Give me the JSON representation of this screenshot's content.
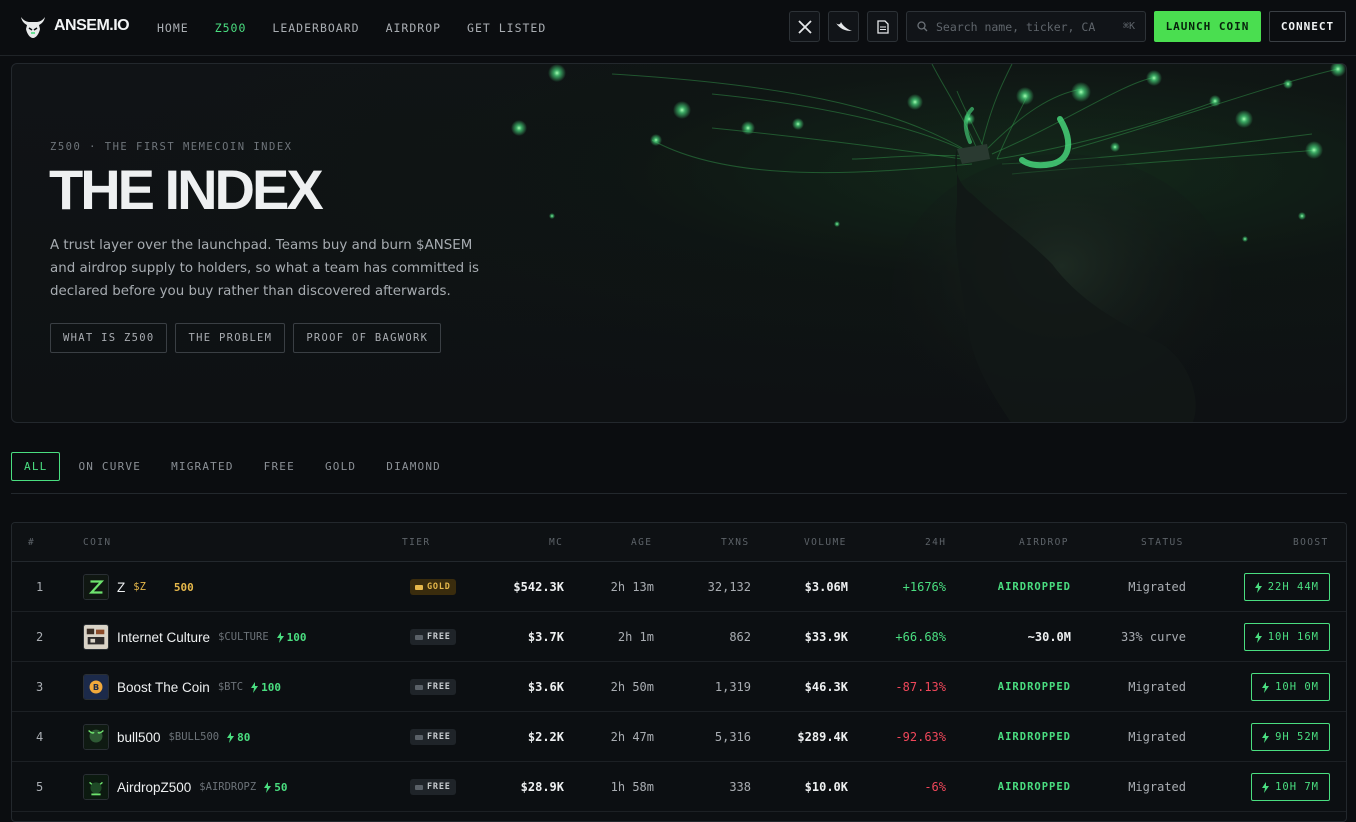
{
  "brand": {
    "name": "ANSEM.IO"
  },
  "nav": {
    "links": [
      "HOME",
      "Z500",
      "LEADERBOARD",
      "AIRDROP",
      "GET LISTED"
    ],
    "active": "Z500"
  },
  "header": {
    "search_placeholder": "Search name, ticker, CA",
    "search_shortcut": "⌘K",
    "launch_label": "LAUNCH COIN",
    "connect_label": "CONNECT",
    "icons": [
      "x-icon",
      "feather-icon",
      "document-icon"
    ]
  },
  "hero": {
    "eyebrow": "Z500 · THE FIRST MEMECOIN INDEX",
    "title": "THE INDEX",
    "description": "A trust layer over the launchpad. Teams buy and burn $ANSEM and airdrop supply to holders, so what a team has committed is declared before you buy rather than discovered afterwards.",
    "buttons": [
      "WHAT IS Z500",
      "THE PROBLEM",
      "PROOF OF BAGWORK"
    ]
  },
  "filters": {
    "tabs": [
      "ALL",
      "ON CURVE",
      "MIGRATED",
      "FREE",
      "GOLD",
      "DIAMOND"
    ],
    "active": "ALL"
  },
  "table": {
    "columns": [
      "#",
      "COIN",
      "TIER",
      "MC",
      "AGE",
      "TXNS",
      "VOLUME",
      "24H",
      "AIRDROP",
      "STATUS",
      "BOOST"
    ],
    "rows": [
      {
        "rank": "1",
        "name": "Z",
        "ticker": "$Z",
        "points": "500",
        "tier": "GOLD",
        "mc": "$542.3K",
        "age": "2h 13m",
        "txns": "32,132",
        "volume": "$3.06M",
        "change": "+1676%",
        "airdrop": "AIRDROPPED",
        "status": "Migrated",
        "boost": "22H 44M"
      },
      {
        "rank": "2",
        "name": "Internet Culture",
        "ticker": "$CULTURE",
        "points": "100",
        "tier": "FREE",
        "mc": "$3.7K",
        "age": "2h 1m",
        "txns": "862",
        "volume": "$33.9K",
        "change": "+66.68%",
        "airdrop": "~30.0M",
        "status": "33% curve",
        "boost": "10H 16M"
      },
      {
        "rank": "3",
        "name": "Boost The Coin",
        "ticker": "$BTC",
        "points": "100",
        "tier": "FREE",
        "mc": "$3.6K",
        "age": "2h 50m",
        "txns": "1,319",
        "volume": "$46.3K",
        "change": "-87.13%",
        "airdrop": "AIRDROPPED",
        "status": "Migrated",
        "boost": "10H 0M"
      },
      {
        "rank": "4",
        "name": "bull500",
        "ticker": "$BULL500",
        "points": "80",
        "tier": "FREE",
        "mc": "$2.2K",
        "age": "2h 47m",
        "txns": "5,316",
        "volume": "$289.4K",
        "change": "-92.63%",
        "airdrop": "AIRDROPPED",
        "status": "Migrated",
        "boost": "9H 52M"
      },
      {
        "rank": "5",
        "name": "AirdropZ500",
        "ticker": "$AIRDROPZ",
        "points": "50",
        "tier": "FREE",
        "mc": "$28.9K",
        "age": "1h 58m",
        "txns": "338",
        "volume": "$10.0K",
        "change": "-6%",
        "airdrop": "AIRDROPPED",
        "status": "Migrated",
        "boost": "10H 7M"
      }
    ]
  },
  "colors": {
    "accent": "#4ade80",
    "gold": "#e6b84b",
    "negative": "#f0475a",
    "background": "#0b0d10"
  }
}
